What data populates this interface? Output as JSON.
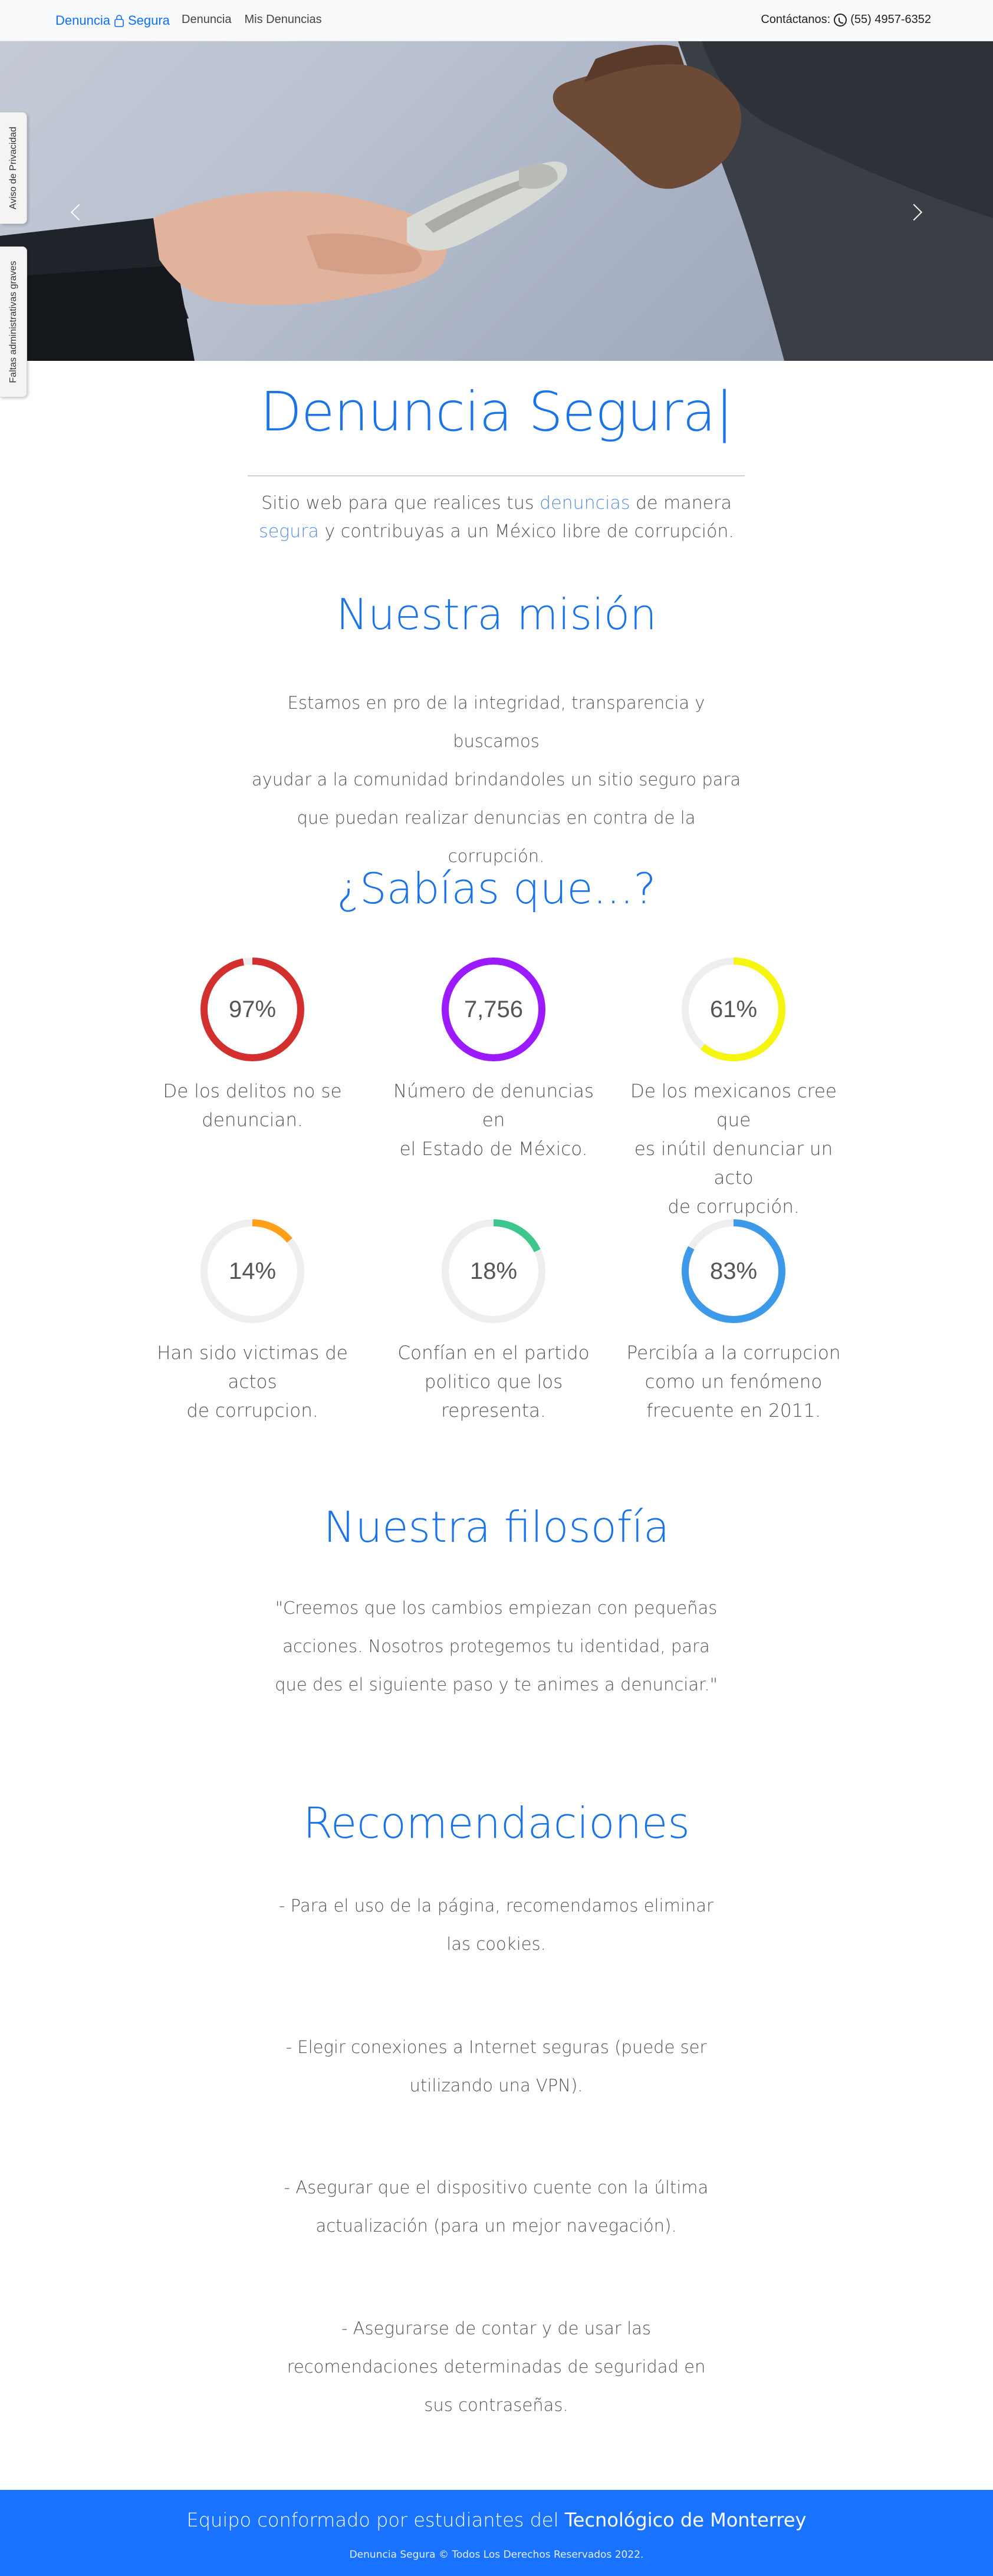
{
  "navbar": {
    "brand_part1": "Denuncia",
    "brand_part2": "Segura",
    "links": [
      "Denuncia",
      "Mis Denuncias"
    ],
    "contact_label": "Contáctanos:",
    "contact_phone": "(55) 4957-6352"
  },
  "side_tabs": {
    "privacy": "Aviso de Privacidad",
    "faltas": "Faltas administrativas graves"
  },
  "hero": {
    "title": "Denuncia Segura|",
    "intro_1": "Sitio web para que realices tus ",
    "intro_hl_1": "denuncias",
    "intro_2": " de manera",
    "intro_hl_2": "segura",
    "intro_3": " y contribuyas a un México libre de corrupción."
  },
  "mision": {
    "title": "Nuestra misión",
    "lines": [
      "Estamos en pro de la integridad, transparencia y buscamos",
      "ayudar a la comunidad brindandoles un sitio seguro para",
      "que puedan realizar denuncias en contra de la corrupción."
    ]
  },
  "sabias": {
    "title": "¿Sabías que...?",
    "stats": [
      {
        "value": "97%",
        "progress": 0.97,
        "color": "#d32f2f",
        "label": [
          "De los delitos no se",
          "denuncian."
        ]
      },
      {
        "value": "7,756",
        "progress": 1.0,
        "color": "#9c1aff",
        "label": [
          "Número de denuncias en",
          "el Estado de México."
        ]
      },
      {
        "value": "61%",
        "progress": 0.61,
        "color": "#f5f510",
        "label": [
          "De los mexicanos cree que",
          "es inútil denunciar un acto",
          "de corrupción."
        ]
      },
      {
        "value": "14%",
        "progress": 0.14,
        "color": "#ff9f1a",
        "label": [
          "Han sido victimas de actos",
          "de corrupcion."
        ]
      },
      {
        "value": "18%",
        "progress": 0.18,
        "color": "#3ec68f",
        "label": [
          "Confían en el partido",
          "politico que los representa."
        ]
      },
      {
        "value": "83%",
        "progress": 0.83,
        "color": "#3d9ae8",
        "label": [
          "Percibía a la corrupcion",
          "como un fenómeno",
          "frecuente en 2011."
        ]
      }
    ],
    "track_color": "#eeeeee"
  },
  "filosofia": {
    "title": "Nuestra filosofía",
    "lines": [
      "\"Creemos que los cambios empiezan con pequeñas",
      "acciones. Nosotros protegemos tu identidad, para",
      "que des el siguiente paso y te animes a denunciar.\""
    ]
  },
  "recomendaciones": {
    "title": "Recomendaciones",
    "items": [
      [
        "- Para el uso de la página, recomendamos eliminar",
        "las cookies."
      ],
      [
        "- Elegir conexiones a Internet seguras (puede ser",
        "utilizando una VPN)."
      ],
      [
        "- Asegurar que el dispositivo cuente con la última",
        "actualización (para un mejor navegación)."
      ],
      [
        "- Asegurarse de contar y de usar las",
        "recomendaciones determinadas de seguridad en",
        "sus contraseñas."
      ]
    ]
  },
  "footer": {
    "team_text": "Equipo conformado por estudiantes del ",
    "team_school": "Tecnológico de Monterrey",
    "copyright": "Denuncia Segura © Todos Los Derechos Reservados 2022."
  }
}
